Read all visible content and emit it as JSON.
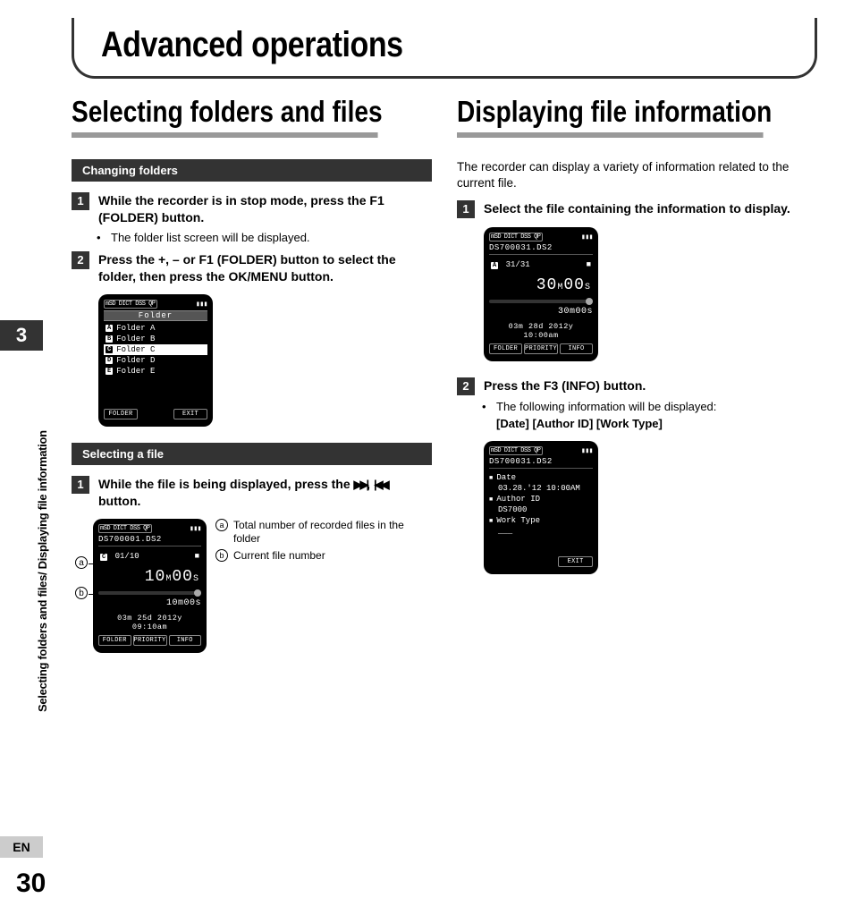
{
  "chapter": {
    "title": "Advanced operations",
    "number": "3"
  },
  "side_label": "Selecting folders and files/ Displaying file information",
  "lang": "EN",
  "page_number": "30",
  "left": {
    "title": "Selecting folders and files",
    "sub_changing": "Changing folders",
    "step1": {
      "n": "1",
      "text_a": "While the recorder is in stop mode, press the ",
      "text_b": "F1",
      "text_c": " (",
      "text_d": "FOLDER",
      "text_e": ") button.",
      "bullet": "The folder list screen will be displayed."
    },
    "step2": {
      "n": "2",
      "text_a": "Press the ",
      "text_b": "+",
      "text_c": ", ",
      "text_d": "–",
      "text_e": " or ",
      "text_f": "F1",
      "text_g": " (",
      "text_h": "FOLDER",
      "text_i": ") button to select the folder, then press the ",
      "text_j": "OK/MENU",
      "text_k": " button."
    },
    "lcd_folder": {
      "title": "Folder",
      "items": [
        {
          "id": "A",
          "label": "Folder A"
        },
        {
          "id": "B",
          "label": "Folder B"
        },
        {
          "id": "C",
          "label": "Folder C"
        },
        {
          "id": "D",
          "label": "Folder D"
        },
        {
          "id": "E",
          "label": "Folder E"
        }
      ],
      "soft_left": "FOLDER",
      "soft_right": "EXIT"
    },
    "sub_selecting": "Selecting a file",
    "step3": {
      "n": "1",
      "text_a": "While the file is being displayed, press the ",
      "text_b": "",
      "text_c": " button."
    },
    "lcd_file": {
      "fname": "DS700001.DS2",
      "folder": "C",
      "cur": "01",
      "tot": "10",
      "elapsed_m": "10",
      "elapsed_s": "00",
      "length": "10m00s",
      "date": "03m 25d 2012y 09:10am",
      "soft1": "FOLDER",
      "soft2": "PRIORITY",
      "soft3": "INFO"
    },
    "callouts": {
      "a": {
        "id": "a",
        "text": "Total number of recorded files in the folder"
      },
      "b": {
        "id": "b",
        "text": "Current file number"
      }
    }
  },
  "right": {
    "title": "Displaying file information",
    "intro": "The recorder can display a variety of information related to the current file.",
    "step1": {
      "n": "1",
      "text": "Select the file containing the information to display."
    },
    "lcd_play": {
      "fname": "DS700031.DS2",
      "folder": "A",
      "cur": "31",
      "tot": "31",
      "elapsed_m": "30",
      "elapsed_s": "00",
      "length": "30m00s",
      "date": "03m 28d 2012y 10:00am",
      "soft1": "FOLDER",
      "soft2": "PRIORITY",
      "soft3": "INFO"
    },
    "step2": {
      "n": "2",
      "text_a": "Press the ",
      "text_b": "F3",
      "text_c": " (",
      "text_d": "INFO",
      "text_e": ") button.",
      "bullet_a": "The following information will be displayed:",
      "bullet_b": "[Date] [Author ID] [Work Type]"
    },
    "lcd_info": {
      "fname": "DS700031.DS2",
      "l1": "Date",
      "v1": "03.28.'12 10:00AM",
      "l2": "Author ID",
      "v2": "DS7000",
      "l3": "Work Type",
      "v3": "___",
      "soft_right": "EXIT"
    }
  },
  "lcd_common": {
    "topbar": "mSD DICT  DSS  QP"
  }
}
